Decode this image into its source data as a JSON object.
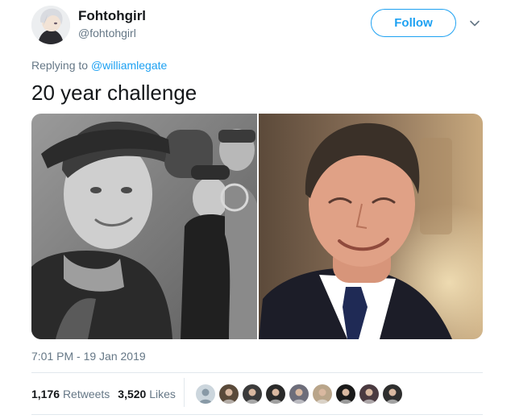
{
  "tweet": {
    "display_name": "Fohtohgirl",
    "handle": "@fohtohgirl",
    "follow_label": "Follow",
    "replying_prefix": "Replying to",
    "replying_to": "@williamlegate",
    "text": "20 year challenge",
    "timestamp": "7:01 PM - 19 Jan 2019",
    "retweets_count": "1,176",
    "retweets_label": "Retweets",
    "likes_count": "3,520",
    "likes_label": "Likes"
  },
  "colors": {
    "accent": "#1da1f2",
    "muted_text": "#657786",
    "primary_text": "#14171a",
    "divider": "#e1e8ed"
  },
  "icons": [
    "chevron-down-icon"
  ],
  "liker_avatars": [
    {
      "color": "#aab8c2"
    },
    {
      "color": "#5a4a3a"
    },
    {
      "color": "#3b3b3b"
    },
    {
      "color": "#2a2a2a"
    },
    {
      "color": "#6d6d7a"
    },
    {
      "color": "#b9a58a"
    },
    {
      "color": "#1a1a1a"
    },
    {
      "color": "#4a3a40"
    },
    {
      "color": "#2e2e2e"
    }
  ]
}
